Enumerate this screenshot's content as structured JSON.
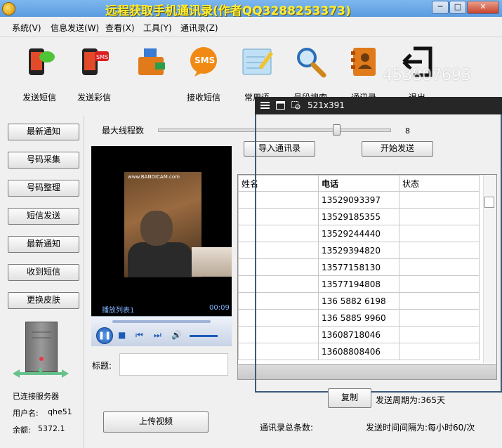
{
  "window": {
    "title": "远程获取手机通讯录(作者QQ3288253373)",
    "minimize": "─",
    "maximize": "□",
    "close": "✕"
  },
  "menu": [
    "系统(V)",
    "信息发送(W)",
    "查看(X)",
    "工具(Y)",
    "通讯录(Z)"
  ],
  "toolbar": [
    {
      "label": "发送短信",
      "icon": "phone-chat-icon"
    },
    {
      "label": "发送彩信",
      "icon": "phone-mms-icon"
    },
    {
      "label": "",
      "icon": "wallet-icon"
    },
    {
      "label": "接收短信",
      "icon": "sms-bubble-icon"
    },
    {
      "label": "常用语",
      "icon": "notepad-icon"
    },
    {
      "label": "号段搜索",
      "icon": "magnifier-icon"
    },
    {
      "label": "通讯录",
      "icon": "contacts-book-icon"
    },
    {
      "label": "退出",
      "icon": "exit-icon"
    }
  ],
  "watermark": "453807693",
  "left_buttons": [
    "最新通知",
    "号码采集",
    "号码整理",
    "短信发送",
    "最新通知",
    "收到短信",
    "更换皮肤"
  ],
  "server": {
    "status": "已连接服务器",
    "username_label": "用户名:",
    "username": "qhe51",
    "balance_label": "余额:",
    "balance": "5372.1"
  },
  "threads": {
    "label": "最大线程数",
    "value": "8",
    "fraction": 0.77
  },
  "buttons": {
    "import": "导入通讯录",
    "start": "开始发送",
    "copy": "复制",
    "upload": "上传视频"
  },
  "video": {
    "watermark": "www.BANDICAM.com",
    "playlist": "播放列表1",
    "time": "00:09"
  },
  "title_label": "标题:",
  "table": {
    "headers": [
      "姓名",
      "电话",
      "状态"
    ],
    "rows": [
      "13529093397",
      "13529185355",
      "13529244440",
      "13529394820",
      "13577158130",
      "13577194808",
      "136 5882 6198",
      "136 5885 9960",
      "13608718046",
      "13608808406"
    ]
  },
  "overlay": {
    "size": "521x391"
  },
  "footer": {
    "period": "发送周期为:365天",
    "total_label": "通讯录总条数:",
    "interval": "发送时间间隔为:每小时60/次"
  }
}
